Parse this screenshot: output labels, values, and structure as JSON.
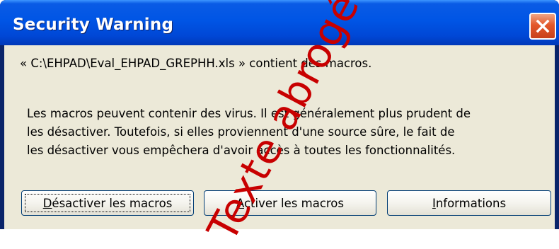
{
  "window": {
    "title": "Security Warning",
    "close_icon": "close-icon"
  },
  "message": {
    "file_line": "« C:\\EHPAD\\Eval_EHPAD_GREPHH.xls » contient des macros.",
    "body_lines": [
      "Les macros peuvent contenir des virus. Il est généralement plus prudent de",
      "les désactiver. Toutefois, si elles proviennent d'une source sûre, le fait de",
      "les désactiver vous empêchera d'avoir accès à toutes les fonctionnalités."
    ]
  },
  "buttons": {
    "disable": {
      "mnemonic": "D",
      "rest": "ésactiver les macros"
    },
    "enable": {
      "mnemonic": "A",
      "rest": "ctiver les macros"
    },
    "info": {
      "mnemonic": "I",
      "rest": "nformations"
    }
  },
  "watermark": {
    "text": "Texte abrogé"
  },
  "colors": {
    "titlebar": "#0055E5",
    "dialog_bg": "#ECE9D8",
    "close_button": "#E3572A",
    "watermark": "#C80000"
  }
}
